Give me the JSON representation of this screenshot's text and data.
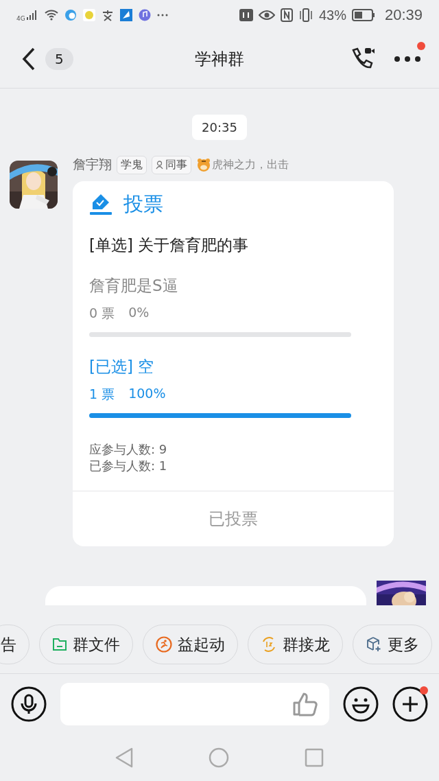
{
  "status_bar": {
    "network": "4G",
    "battery_percent": "43%",
    "time": "20:39"
  },
  "header": {
    "unread_count": "5",
    "title": "学神群",
    "menu_badge": true
  },
  "timestamp": "20:35",
  "message": {
    "sender": "詹宇翔",
    "tags": [
      {
        "kind": "title",
        "label": "学鬼"
      },
      {
        "kind": "role",
        "label": "同事"
      }
    ],
    "signature": "虎神之力，出击",
    "poll": {
      "heading": "投票",
      "question": "[单选] 关于詹育肥的事",
      "options": [
        {
          "label": "詹育肥是S逼",
          "votes": "0 票",
          "percent": "0%",
          "selected": false
        },
        {
          "label": "[已选] 空",
          "votes": "1 票",
          "percent": "100%",
          "selected": true,
          "level": 1
        }
      ],
      "expected": "应参与人数: 9",
      "participated": "已参与人数: 1",
      "action": "已投票"
    }
  },
  "quick_actions": [
    {
      "kind": "notice",
      "label": "告"
    },
    {
      "kind": "files",
      "label": "群文件"
    },
    {
      "kind": "launch",
      "label": "益起动"
    },
    {
      "kind": "relay",
      "label": "群接龙"
    },
    {
      "kind": "more",
      "label": "更多"
    }
  ],
  "input": {
    "plus_badge": true
  }
}
